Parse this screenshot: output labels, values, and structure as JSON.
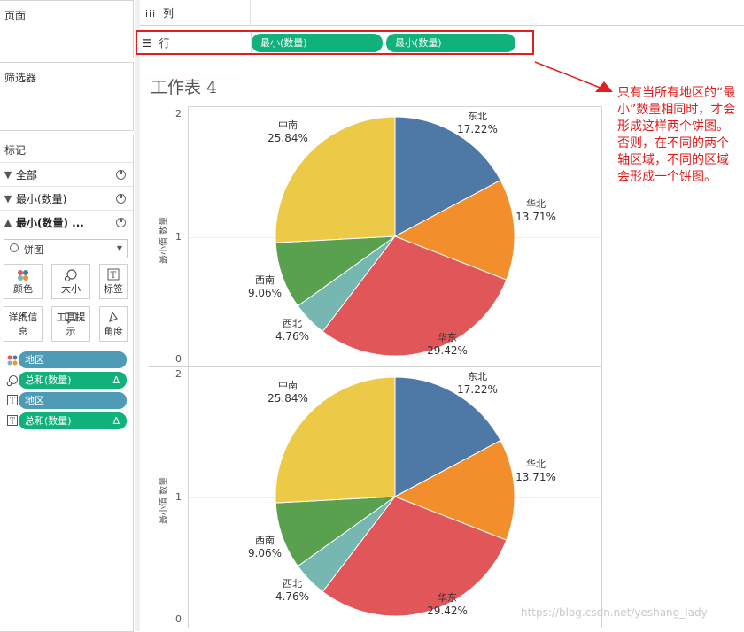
{
  "left": {
    "pages_title": "页面",
    "filters_title": "筛选器",
    "marks_title": "标记",
    "mark_rows": [
      {
        "label": "全部"
      },
      {
        "label": "最小(数量)"
      },
      {
        "label": "最小(数量) ..."
      }
    ],
    "mark_type": "饼图",
    "buttons": [
      {
        "label": "颜色",
        "icon": "color-dots-icon"
      },
      {
        "label": "大小",
        "icon": "size-icon"
      },
      {
        "label": "标签",
        "icon": "label-T-icon"
      },
      {
        "label": "详细信息",
        "icon": "detail-dots-icon"
      },
      {
        "label": "工具提示",
        "icon": "tooltip-icon"
      },
      {
        "label": "角度",
        "icon": "angle-icon"
      }
    ],
    "pills": [
      {
        "label": "地区",
        "color": "#4e9bb5",
        "delta": ""
      },
      {
        "label": "总和(数量)",
        "color": "#10b17a",
        "delta": "Δ"
      },
      {
        "label": "地区",
        "color": "#4e9bb5",
        "delta": ""
      },
      {
        "label": "总和(数量)",
        "color": "#10b17a",
        "delta": "Δ"
      }
    ]
  },
  "shelves": {
    "columns_label": "列",
    "rows_label": "行",
    "row_pills": [
      "最小(数量)",
      "最小(数量)"
    ]
  },
  "sheet_title": "工作表 4",
  "annotation": "只有当所有地区的“最小”数量相同时，才会形成这样两个饼图。否则，在不同的两个轴区域，不同的区域会形成一个饼图。",
  "watermark": "https://blog.csdn.net/yeshang_lady",
  "colors": {
    "accent_green": "#10b17a",
    "accent_blue": "#4e9bb5",
    "annotation_red": "#e01b1b"
  },
  "chart_data": [
    {
      "type": "pie",
      "axis_title": "最小值 数量",
      "y_ticks": [
        "2",
        "1",
        "0"
      ],
      "categories": [
        "东北",
        "华北",
        "华东",
        "西北",
        "西南",
        "中南"
      ],
      "values": [
        17.22,
        13.71,
        29.42,
        4.76,
        9.06,
        25.84
      ],
      "labels": [
        "17.22%",
        "13.71%",
        "29.42%",
        "4.76%",
        "9.06%",
        "25.84%"
      ],
      "colors": [
        "#4e79a7",
        "#f28e2b",
        "#e15759",
        "#76b7b2",
        "#59a14f",
        "#edc948"
      ]
    },
    {
      "type": "pie",
      "axis_title": "最小值 数量",
      "y_ticks": [
        "2",
        "1",
        "0"
      ],
      "categories": [
        "东北",
        "华北",
        "华东",
        "西北",
        "西南",
        "中南"
      ],
      "values": [
        17.22,
        13.71,
        29.42,
        4.76,
        9.06,
        25.84
      ],
      "labels": [
        "17.22%",
        "13.71%",
        "29.42%",
        "4.76%",
        "9.06%",
        "25.84%"
      ],
      "colors": [
        "#4e79a7",
        "#f28e2b",
        "#e15759",
        "#76b7b2",
        "#59a14f",
        "#edc948"
      ]
    }
  ]
}
